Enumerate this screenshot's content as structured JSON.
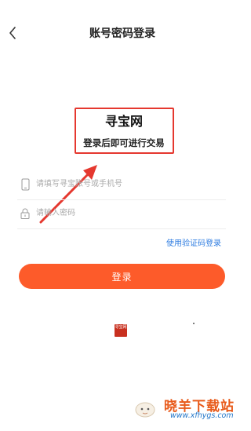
{
  "header": {
    "title": "账号密码登录",
    "back_icon": "chevron-left-icon"
  },
  "brand": {
    "name": "寻宝网",
    "subtitle": "登录后即可进行交易"
  },
  "form": {
    "account_placeholder": "请填写寻宝账号或手机号",
    "account_icon": "phone-icon",
    "password_placeholder": "请输入密码",
    "password_icon": "lock-icon"
  },
  "alt_login_label": "使用验证码登录",
  "login_button_label": "登录",
  "stamp_text": "寻宝网",
  "watermark": {
    "title": "晓羊下载站",
    "url": "www.xfhygs.com"
  },
  "colors": {
    "accent": "#fd5b2a",
    "link": "#2f7de1",
    "annotation": "#e5382f"
  }
}
